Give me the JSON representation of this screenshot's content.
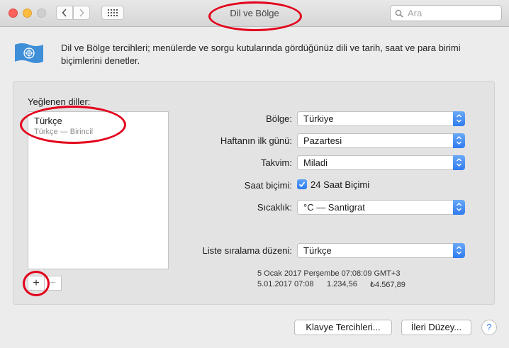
{
  "window": {
    "title": "Dil ve Bölge",
    "search_placeholder": "Ara"
  },
  "icons": {
    "back": "chevron-left-icon",
    "forward": "chevron-right-icon",
    "grid": "grid-icon",
    "search": "magnifier-icon",
    "flag": "un-flag-icon"
  },
  "description": "Dil ve Bölge tercihleri; menülerde ve sorgu kutularında gördüğünüz dili ve tarih, saat ve para birimi biçimlerini denetler.",
  "preferred_languages": {
    "label": "Yeğlenen diller:",
    "items": [
      {
        "name": "Türkçe",
        "subtitle": "Türkçe — Birincil"
      }
    ],
    "add_label": "+",
    "remove_label": "−"
  },
  "settings": {
    "region": {
      "label": "Bölge:",
      "value": "Türkiye"
    },
    "first_day": {
      "label": "Haftanın ilk günü:",
      "value": "Pazartesi"
    },
    "calendar": {
      "label": "Takvim:",
      "value": "Miladi"
    },
    "time_format": {
      "label": "Saat biçimi:",
      "checkbox_label": "24 Saat Biçimi",
      "checked": true
    },
    "temperature": {
      "label": "Sıcaklık:",
      "value": "°C — Santigrat"
    },
    "sort_order": {
      "label": "Liste sıralama düzeni:",
      "value": "Türkçe"
    }
  },
  "sample": {
    "line1": "5 Ocak 2017 Perşembe 07:08:09 GMT+3",
    "date": "5.01.2017 07:08",
    "number": "1.234,56",
    "currency": "₺4.567,89"
  },
  "buttons": {
    "keyboard": "Klavye Tercihleri...",
    "advanced": "İleri Düzey...",
    "help": "?"
  },
  "colors": {
    "accent": "#2f7bf0",
    "annotation": "#e3001b",
    "close": "#fc605c",
    "minimize": "#fdbc40",
    "flag_blue": "#3f8fd8"
  }
}
